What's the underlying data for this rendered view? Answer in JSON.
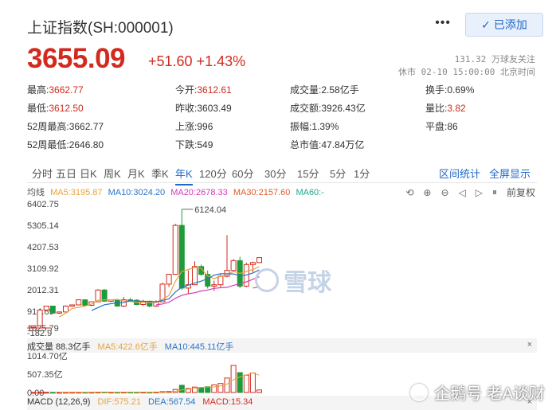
{
  "header": {
    "title": "上证指数(SH:000001)",
    "more": "•••",
    "add_label": "已添加",
    "add_icon": "check-icon"
  },
  "quote": {
    "price": "3655.09",
    "change": "+51.60 +1.43%",
    "follow": "131.32 万球友关注",
    "market_time": "休市 02-10 15:00:00 北京时间"
  },
  "stats": [
    {
      "k": "最高:",
      "v": "3662.77",
      "color": "red"
    },
    {
      "k": "今开:",
      "v": "3612.61",
      "color": "red"
    },
    {
      "k": "成交量:",
      "v": "2.58亿手",
      "color": "normal"
    },
    {
      "k": "换手:",
      "v": "0.69%",
      "color": "normal"
    },
    {
      "k": "最低:",
      "v": "3612.50",
      "color": "red"
    },
    {
      "k": "昨收:",
      "v": "3603.49",
      "color": "normal"
    },
    {
      "k": "成交额:",
      "v": "3926.43亿",
      "color": "normal"
    },
    {
      "k": "量比:",
      "v": "3.82",
      "color": "red"
    },
    {
      "k": "52周最高:",
      "v": "3662.77",
      "color": "normal"
    },
    {
      "k": "上涨:",
      "v": "996",
      "color": "normal"
    },
    {
      "k": "振幅:",
      "v": "1.39%",
      "color": "normal"
    },
    {
      "k": "平盘:",
      "v": "86",
      "color": "normal"
    },
    {
      "k": "52周最低:",
      "v": "2646.80",
      "color": "normal"
    },
    {
      "k": "下跌:",
      "v": "549",
      "color": "normal"
    },
    {
      "k": "总市值:",
      "v": "47.84万亿",
      "color": "normal"
    }
  ],
  "tabs": [
    "分时",
    "五日",
    "日K",
    "周K",
    "月K",
    "季K",
    "年K",
    "120分",
    "60分",
    "30分",
    "15分",
    "5分",
    "1分"
  ],
  "active_tab": "年K",
  "tab_links": [
    "区间统计",
    "全屏显示"
  ],
  "ma_legend": {
    "base": "均线",
    "ma5": "MA5:3195.87",
    "ma10": "MA10:3024.20",
    "ma20": "MA20:2678.33",
    "ma30": "MA30:2157.60",
    "ma60": "MA60:-"
  },
  "toolbox": {
    "fuquan": "前复权"
  },
  "price_axis": [
    "6402.75",
    "5305.14",
    "4207.53",
    "3109.92",
    "2012.31",
    "914.69",
    "-182.9"
  ],
  "price_axis_overlay": "1025.79",
  "max_label": "6124.04",
  "volume": {
    "label": "成交量 88.3亿手",
    "ma5": "MA5:422.6亿手",
    "ma10": "MA10:445.11亿手",
    "axis": [
      "1014.70亿",
      "507.35亿",
      "0.00"
    ]
  },
  "macd": {
    "label": "MACD (12,26,9)",
    "dif": "DIF:575.21",
    "dea": "DEA:567.54",
    "macd": "MACD:15.34"
  },
  "watermark": "雪球",
  "footer_wm": "企鹅号 老A谈财",
  "colors": {
    "red": "#d22a1e",
    "green": "#1e9b3a",
    "blue": "#1f67c9",
    "ma5": "#e8a33b",
    "ma10": "#2a73c7",
    "ma20": "#d23bb6",
    "ma30": "#e05b2a",
    "ma60": "#1aa68f"
  },
  "candles": [
    {
      "o": 100,
      "c": 180,
      "h": 180,
      "l": 95
    },
    {
      "o": 180,
      "c": 980,
      "h": 1010,
      "l": 180
    },
    {
      "o": 980,
      "c": 1180,
      "h": 1200,
      "l": 960
    },
    {
      "o": 1180,
      "c": 820,
      "h": 1200,
      "l": 800
    },
    {
      "o": 820,
      "c": 880,
      "h": 900,
      "l": 780
    },
    {
      "o": 880,
      "c": 1180,
      "h": 1220,
      "l": 860
    },
    {
      "o": 1180,
      "c": 1240,
      "h": 1260,
      "l": 1150
    },
    {
      "o": 1240,
      "c": 1500,
      "h": 1530,
      "l": 1220
    },
    {
      "o": 1500,
      "c": 1220,
      "h": 1520,
      "l": 1200
    },
    {
      "o": 1220,
      "c": 1400,
      "h": 1420,
      "l": 1180
    },
    {
      "o": 1400,
      "c": 2000,
      "h": 2050,
      "l": 1400
    },
    {
      "o": 2000,
      "c": 1430,
      "h": 2050,
      "l": 1400
    },
    {
      "o": 1430,
      "c": 1500,
      "h": 1520,
      "l": 1380
    },
    {
      "o": 1500,
      "c": 1180,
      "h": 1520,
      "l": 1150
    },
    {
      "o": 1180,
      "c": 1500,
      "h": 1650,
      "l": 1130
    },
    {
      "o": 1500,
      "c": 1480,
      "h": 1600,
      "l": 1400
    },
    {
      "o": 1480,
      "c": 1260,
      "h": 1520,
      "l": 1230
    },
    {
      "o": 1260,
      "c": 1430,
      "h": 1500,
      "l": 1200
    },
    {
      "o": 1430,
      "c": 1180,
      "h": 1450,
      "l": 1120
    },
    {
      "o": 1180,
      "c": 1400,
      "h": 1480,
      "l": 1140
    },
    {
      "o": 1400,
      "c": 2300,
      "h": 2380,
      "l": 1380
    },
    {
      "o": 2300,
      "c": 2800,
      "h": 2820,
      "l": 2150
    },
    {
      "o": 2800,
      "c": 5300,
      "h": 5380,
      "l": 2800
    },
    {
      "o": 5300,
      "c": 2100,
      "h": 6124,
      "l": 2000
    },
    {
      "o": 2100,
      "c": 2270,
      "h": 3000,
      "l": 1820
    },
    {
      "o": 2270,
      "c": 3200,
      "h": 3470,
      "l": 2250
    },
    {
      "o": 3200,
      "c": 2800,
      "h": 3300,
      "l": 2720
    },
    {
      "o": 2800,
      "c": 2200,
      "h": 3000,
      "l": 2080
    },
    {
      "o": 2200,
      "c": 2270,
      "h": 2480,
      "l": 1950
    },
    {
      "o": 2270,
      "c": 2700,
      "h": 2800,
      "l": 2150
    },
    {
      "o": 2700,
      "c": 3000,
      "h": 4800,
      "l": 2650
    },
    {
      "o": 3000,
      "c": 3500,
      "h": 3580,
      "l": 2950
    },
    {
      "o": 3500,
      "c": 2200,
      "h": 3700,
      "l": 2100
    },
    {
      "o": 2200,
      "c": 3300,
      "h": 3400,
      "l": 2140
    },
    {
      "o": 3300,
      "c": 3400,
      "h": 3450,
      "l": 2900
    },
    {
      "o": 3400,
      "c": 3655,
      "h": 3662,
      "l": 3400
    }
  ],
  "volumes": [
    2,
    4,
    5,
    4,
    3,
    5,
    6,
    6,
    5,
    6,
    10,
    12,
    9,
    8,
    10,
    9,
    9,
    10,
    8,
    12,
    25,
    30,
    85,
    200,
    110,
    150,
    140,
    160,
    210,
    250,
    400,
    750,
    550,
    480,
    540,
    70
  ],
  "ma5_line": [
    null,
    null,
    null,
    null,
    620,
    820,
    1060,
    1120,
    1180,
    1280,
    1480,
    1500,
    1500,
    1520,
    1440,
    1420,
    1380,
    1380,
    1350,
    1360,
    1530,
    1720,
    2450,
    2950,
    3050,
    3150,
    3100,
    2720,
    2580,
    2700,
    2760,
    2950,
    2850,
    2950,
    3050,
    3196
  ],
  "ma10_line": [
    null,
    null,
    null,
    null,
    null,
    null,
    null,
    null,
    null,
    960,
    1100,
    1250,
    1300,
    1350,
    1360,
    1450,
    1440,
    1420,
    1420,
    1400,
    1470,
    1550,
    1900,
    2150,
    2250,
    2360,
    2450,
    2580,
    2760,
    2830,
    2830,
    2820,
    2730,
    2770,
    2870,
    3024
  ],
  "ma20_line": [
    null,
    null,
    null,
    null,
    null,
    null,
    null,
    null,
    null,
    null,
    null,
    null,
    null,
    null,
    null,
    null,
    null,
    null,
    null,
    1240,
    1290,
    1380,
    1580,
    1730,
    1810,
    1860,
    1950,
    2000,
    2080,
    2120,
    2140,
    2240,
    2320,
    2420,
    2550,
    2678
  ],
  "ma30_line": [
    null,
    null,
    null,
    null,
    null,
    null,
    null,
    null,
    null,
    null,
    null,
    null,
    null,
    null,
    null,
    null,
    null,
    null,
    null,
    null,
    null,
    null,
    null,
    null,
    null,
    null,
    null,
    null,
    null,
    null,
    null,
    null,
    null,
    null,
    2100,
    2158
  ]
}
